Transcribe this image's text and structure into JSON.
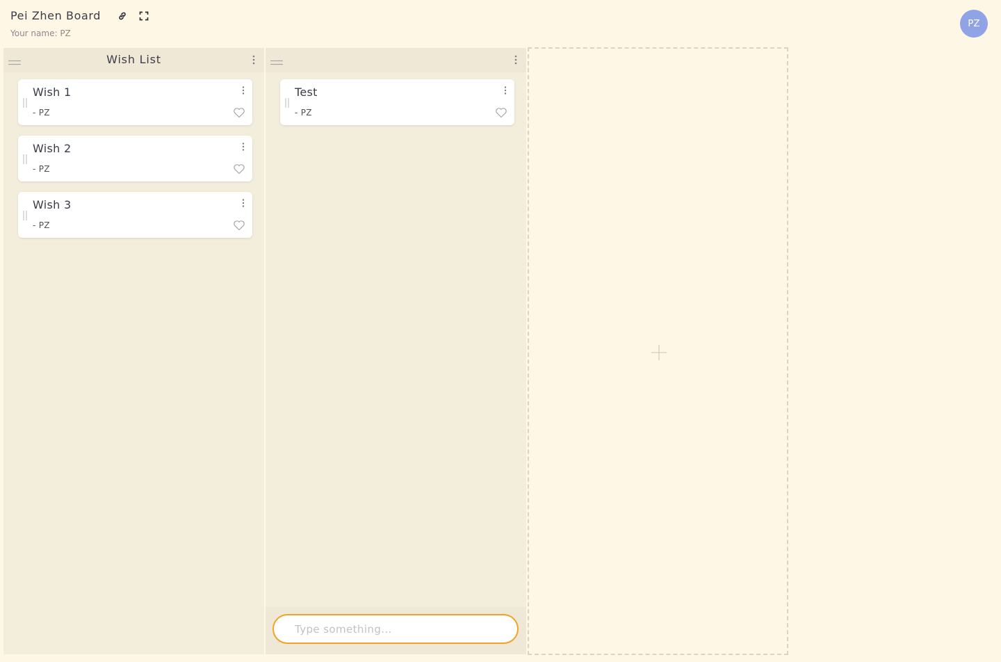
{
  "header": {
    "board_title": "Pei Zhen Board",
    "your_name_label": "Your name: PZ",
    "avatar_initials": "PZ",
    "avatar_color": "#8fa3e6",
    "icons": [
      "link-icon",
      "expand-icon"
    ]
  },
  "columns": [
    {
      "title": "Wish List",
      "cards": [
        {
          "title": "Wish 1",
          "author": "- PZ"
        },
        {
          "title": "Wish 2",
          "author": "- PZ"
        },
        {
          "title": "Wish 3",
          "author": "- PZ"
        }
      ]
    },
    {
      "title": "",
      "cards": [
        {
          "title": "Test",
          "author": "- PZ"
        }
      ],
      "new_card_input": {
        "placeholder": "Type something...",
        "value": ""
      }
    }
  ],
  "colors": {
    "background": "#fef7e6",
    "column": "#f3eddc",
    "input_border": "#f0a325"
  }
}
